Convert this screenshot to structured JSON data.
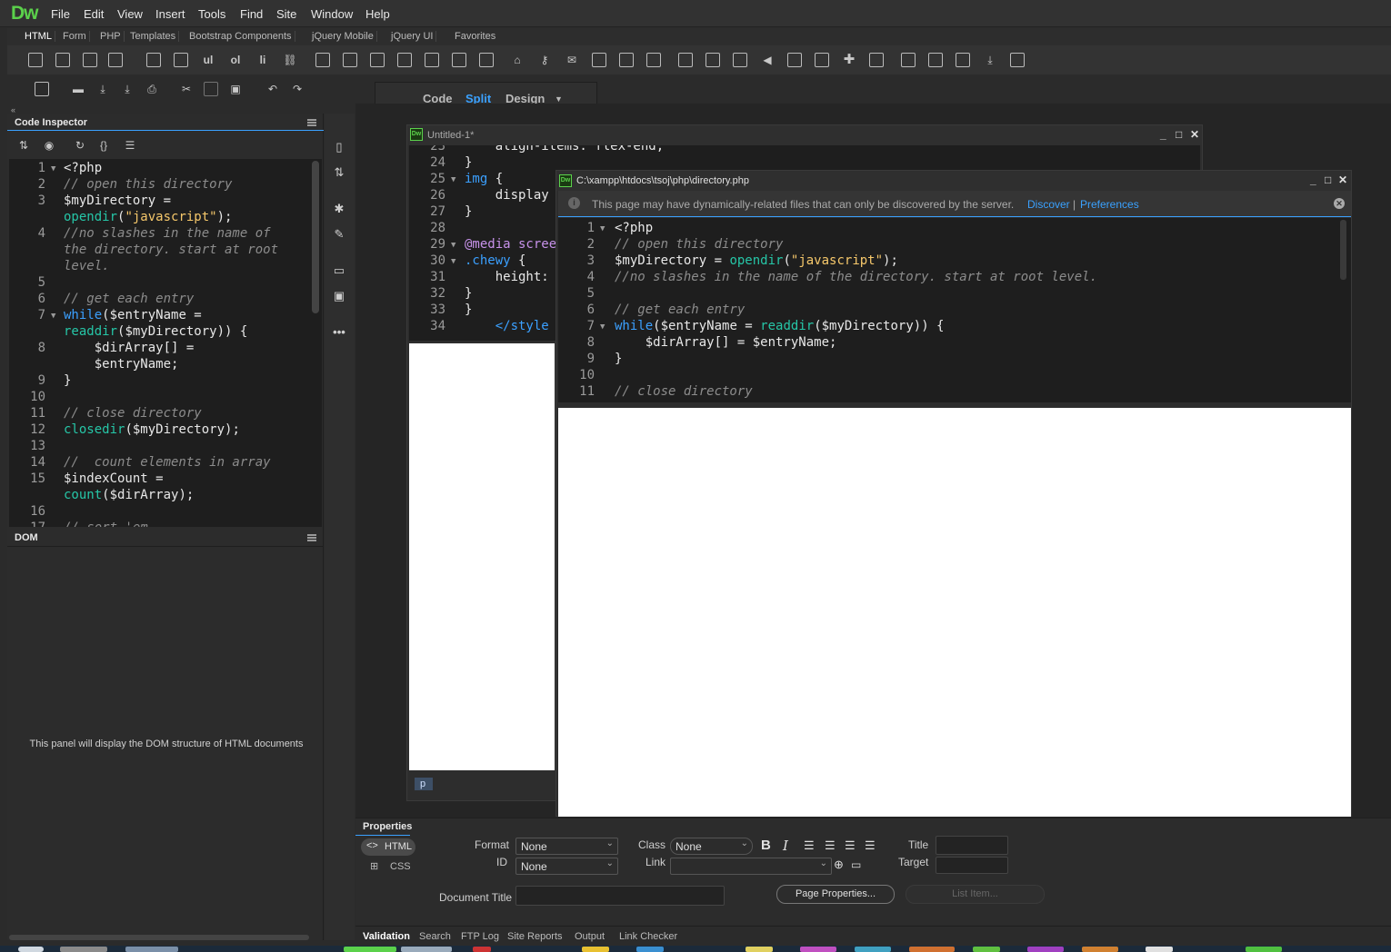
{
  "app": {
    "logo": "Dw"
  },
  "menubar": {
    "items": [
      "File",
      "Edit",
      "View",
      "Insert",
      "Tools",
      "Find",
      "Site",
      "Window",
      "Help"
    ]
  },
  "insert_tabs": [
    "HTML",
    "Form",
    "PHP",
    "Templates",
    "Bootstrap Components",
    "jQuery Mobile",
    "jQuery UI",
    "Favorites"
  ],
  "view_tabs": {
    "code": "Code",
    "split": "Split",
    "design": "Design",
    "active": "Split"
  },
  "code_inspector": {
    "title": "Code Inspector",
    "lines": [
      {
        "n": "1",
        "fold": true,
        "html": "<span class='pu'>&lt;?php</span>"
      },
      {
        "n": "2",
        "html": "<span class='cm'>// open this directory</span>"
      },
      {
        "n": "3",
        "html": "<span class='va'>$myDirectory =</span>"
      },
      {
        "n": "",
        "html": "<span class='fn'>opendir</span><span class='pu'>(</span><span class='st'>\"javascript\"</span><span class='pu'>);</span>"
      },
      {
        "n": "4",
        "html": "<span class='cm'>//no slashes in the name of</span>"
      },
      {
        "n": "",
        "html": "<span class='cm'>the directory. start at root</span>"
      },
      {
        "n": "",
        "html": "<span class='cm'>level.</span>"
      },
      {
        "n": "5",
        "html": ""
      },
      {
        "n": "6",
        "html": "<span class='cm'>// get each entry</span>"
      },
      {
        "n": "7",
        "fold": true,
        "html": "<span class='kw'>while</span><span class='pu'>($entryName =</span>"
      },
      {
        "n": "",
        "html": "<span class='fn'>readdir</span><span class='pu'>($myDirectory)) {</span>"
      },
      {
        "n": "8",
        "html": "    <span class='va'>$dirArray[] =</span>"
      },
      {
        "n": "",
        "html": "    <span class='va'>$entryName;</span>"
      },
      {
        "n": "9",
        "html": "<span class='pu'>}</span>"
      },
      {
        "n": "10",
        "html": ""
      },
      {
        "n": "11",
        "html": "<span class='cm'>// close directory</span>"
      },
      {
        "n": "12",
        "html": "<span class='fn'>closedir</span><span class='pu'>($myDirectory);</span>"
      },
      {
        "n": "13",
        "html": ""
      },
      {
        "n": "14",
        "html": "<span class='cm'>//  count elements in array</span>"
      },
      {
        "n": "15",
        "html": "<span class='va'>$indexCount =</span>"
      },
      {
        "n": "",
        "html": "<span class='fn'>count</span><span class='pu'>($dirArray);</span>"
      },
      {
        "n": "16",
        "html": ""
      },
      {
        "n": "17",
        "html": "<span class='cm'>// sort 'em</span>"
      }
    ]
  },
  "dom_panel": {
    "title": "DOM",
    "message": "This panel will display the DOM structure of HTML documents"
  },
  "untitled_window": {
    "title": "Untitled-1*",
    "lines": [
      {
        "n": "23",
        "html": "    <span class='va'>align-items: flex-end;</span>"
      },
      {
        "n": "24",
        "html": "<span class='pu'>}</span>"
      },
      {
        "n": "25",
        "fold": true,
        "html": "<span class='kw'>img</span> <span class='pu'>{</span>"
      },
      {
        "n": "26",
        "html": "    <span class='va'>display</span>"
      },
      {
        "n": "27",
        "html": "<span class='pu'>}</span>"
      },
      {
        "n": "28",
        "html": ""
      },
      {
        "n": "29",
        "fold": true,
        "html": "<span class='pr'>@media scree</span>"
      },
      {
        "n": "30",
        "fold": true,
        "html": "<span class='kw'>.chewy</span> <span class='pu'>{</span>"
      },
      {
        "n": "31",
        "html": "    <span class='va'>height:</span>"
      },
      {
        "n": "32",
        "html": "<span class='pu'>}</span>"
      },
      {
        "n": "33",
        "html": "<span class='pu'>}</span>"
      },
      {
        "n": "34",
        "html": "    <span class='kw'>&lt;/style</span>"
      }
    ],
    "status_tag": "p"
  },
  "php_window": {
    "title": "C:\\xampp\\htdocs\\tsoj\\php\\directory.php",
    "info_text": "This page may have dynamically-related files that can only be discovered by the server.",
    "discover": "Discover",
    "separator": "|",
    "preferences": "Preferences",
    "lines": [
      {
        "n": "1",
        "fold": true,
        "html": "<span class='pu'>&lt;?php</span>"
      },
      {
        "n": "2",
        "html": "<span class='cm'>// open this directory</span>"
      },
      {
        "n": "3",
        "html": "<span class='va'>$myDirectory = </span><span class='fn'>opendir</span><span class='pu'>(</span><span class='st'>\"javascript\"</span><span class='pu'>);</span>"
      },
      {
        "n": "4",
        "html": "<span class='cm'>//no slashes in the name of the directory. start at root level.</span>"
      },
      {
        "n": "5",
        "html": ""
      },
      {
        "n": "6",
        "html": "<span class='cm'>// get each entry</span>"
      },
      {
        "n": "7",
        "fold": true,
        "html": "<span class='kw'>while</span><span class='pu'>($entryName = </span><span class='fn'>readdir</span><span class='pu'>($myDirectory)) {</span>"
      },
      {
        "n": "8",
        "html": "    <span class='va'>$dirArray[] = $entryName;</span>"
      },
      {
        "n": "9",
        "html": "<span class='pu'>}</span>"
      },
      {
        "n": "10",
        "html": ""
      },
      {
        "n": "11",
        "html": "<span class='cm'>// close directory</span>"
      }
    ]
  },
  "properties": {
    "title": "Properties",
    "html_tab": "HTML",
    "css_tab": "CSS",
    "format_label": "Format",
    "format_value": "None",
    "id_label": "ID",
    "id_value": "None",
    "class_label": "Class",
    "class_value": "None",
    "link_label": "Link",
    "title_label": "Title",
    "target_label": "Target",
    "doc_title_label": "Document Title",
    "page_props_btn": "Page Properties...",
    "list_item_btn": "List Item..."
  },
  "bottom_tabs": [
    "Validation",
    "Search",
    "FTP Log",
    "Site Reports",
    "Output",
    "Link Checker"
  ],
  "colors": {
    "accent": "#3aa1ff",
    "logo": "#5bd14b"
  }
}
